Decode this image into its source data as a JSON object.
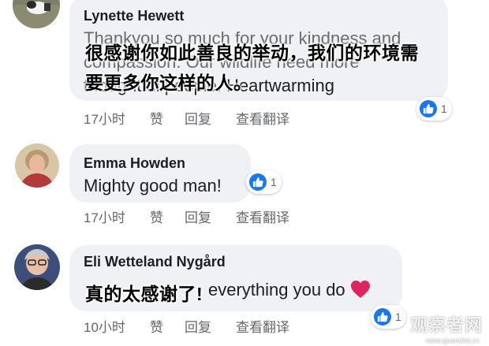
{
  "comments": [
    {
      "author": "Lynette Hewett",
      "text_line1": "Thankyou so much for your kindness and",
      "text_line2": "compassion. Our wildlife need more",
      "text_line3": "thoughtful people. Heartwarming",
      "translation_line1": "很感谢你如此善良的举动，我们的环境需",
      "translation_line2": "要更多你这样的人。",
      "time": "17小时",
      "like_label": "赞",
      "reply_label": "回复",
      "translate_label": "查看翻译",
      "reaction_count": "1"
    },
    {
      "author": "Emma Howden",
      "text": "Mighty good man!",
      "time": "17小时",
      "like_label": "赞",
      "reply_label": "回复",
      "translate_label": "查看翻译",
      "reaction_count": "1"
    },
    {
      "author": "Eli Wetteland Nygård",
      "text": "everything you do",
      "translation": "真的太感谢了!",
      "time": "10小时",
      "like_label": "赞",
      "reply_label": "回复",
      "translate_label": "查看翻译",
      "reaction_count": "1"
    }
  ],
  "watermark": {
    "text": "观察者网",
    "subtext": "www.guancha.cn"
  },
  "colors": {
    "bubble": "#eff1f4",
    "like_blue": "#1877f2",
    "meta_gray": "#65676b",
    "heart_red": "#e0245e"
  }
}
